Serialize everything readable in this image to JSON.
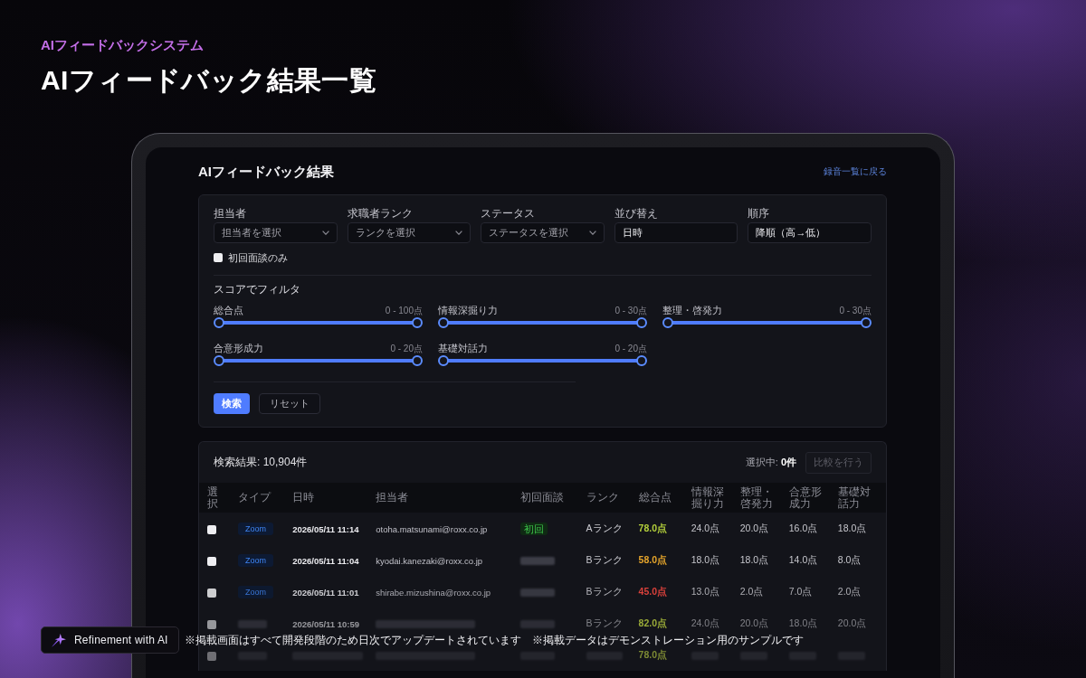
{
  "header": {
    "eyebrow": "AIフィードバックシステム",
    "title": "AIフィードバック結果一覧"
  },
  "screen": {
    "title": "AIフィードバック結果",
    "back_link": "録音一覧に戻る",
    "filters": {
      "fields": [
        {
          "label": "担当者",
          "kind": "select",
          "placeholder": "担当者を選択"
        },
        {
          "label": "求職者ランク",
          "kind": "select",
          "placeholder": "ランクを選択"
        },
        {
          "label": "ステータス",
          "kind": "select",
          "placeholder": "ステータスを選択"
        },
        {
          "label": "並び替え",
          "kind": "input",
          "value": "日時"
        },
        {
          "label": "順序",
          "kind": "input",
          "value": "降順（高→低）"
        }
      ],
      "first_interview_only": {
        "label": "初回面談のみ",
        "checked": false
      },
      "score_heading": "スコアでフィルタ",
      "score_sliders": [
        {
          "label": "総合点",
          "range": "0 - 100点",
          "level": 1
        },
        {
          "label": "情報深掘り力",
          "range": "0 - 30点",
          "level": 1
        },
        {
          "label": "整理・啓発力",
          "range": "0 - 30点",
          "level": 1
        },
        {
          "label": "合意形成力",
          "range": "0 - 20点",
          "level": 1
        },
        {
          "label": "基礎対話力",
          "range": "0 - 20点",
          "level": 1
        }
      ],
      "buttons": [
        {
          "label": "検索",
          "kind": "primary"
        },
        {
          "label": "リセット",
          "kind": "secondary"
        }
      ]
    },
    "results": {
      "count": "検索結果: 10,904件",
      "selection": "選択中: **0件**",
      "compare_button": {
        "label": "比較を行う",
        "disabled": true
      },
      "table": {
        "columns": [
          "選択",
          "タイプ",
          "日時",
          "担当者",
          "初回面談",
          "ランク",
          "総合点",
          "情報深掘り力",
          "整理・啓発力",
          "合意形成力",
          "基礎対話力"
        ],
        "rows": [
          {
            "cells": [
              {
                "kind": "checkbox",
                "checked": false
              },
              {
                "kind": "type_badge",
                "text": "Zoom"
              },
              {
                "kind": "datetime",
                "text": "2026/05/11 11:14"
              },
              {
                "kind": "text",
                "text": "otoha.matsunami@roxx.co.jp"
              },
              {
                "kind": "first_badge",
                "text": "初回"
              },
              {
                "kind": "text",
                "text": "Aランク"
              },
              {
                "kind": "score",
                "text": "78.0点",
                "color": "#b3cf3b"
              },
              {
                "kind": "text",
                "text": "24.0点"
              },
              {
                "kind": "text",
                "text": "20.0点"
              },
              {
                "kind": "text",
                "text": "16.0点"
              },
              {
                "kind": "text",
                "text": "18.0点"
              }
            ]
          },
          {
            "cells": [
              {
                "kind": "checkbox",
                "checked": false
              },
              {
                "kind": "type_badge",
                "text": "Zoom"
              },
              {
                "kind": "datetime",
                "text": "2026/05/11 11:04"
              },
              {
                "kind": "text",
                "text": "kyodai.kanezaki@roxx.co.jp"
              },
              {
                "kind": "blurred"
              },
              {
                "kind": "text",
                "text": "Bランク"
              },
              {
                "kind": "score",
                "text": "58.0点",
                "color": "#e6a52b"
              },
              {
                "kind": "text",
                "text": "18.0点"
              },
              {
                "kind": "text",
                "text": "18.0点"
              },
              {
                "kind": "text",
                "text": "14.0点"
              },
              {
                "kind": "text",
                "text": "8.0点"
              }
            ]
          },
          {
            "cells": [
              {
                "kind": "checkbox",
                "checked": false
              },
              {
                "kind": "type_badge",
                "text": "Zoom"
              },
              {
                "kind": "datetime",
                "text": "2026/05/11 11:01"
              },
              {
                "kind": "text",
                "text": "shirabe.mizushina@roxx.co.jp"
              },
              {
                "kind": "blurred"
              },
              {
                "kind": "text",
                "text": "Bランク"
              },
              {
                "kind": "score",
                "text": "45.0点",
                "color": "#d9413b"
              },
              {
                "kind": "text",
                "text": "13.0点"
              },
              {
                "kind": "text",
                "text": "2.0点"
              },
              {
                "kind": "text",
                "text": "7.0点"
              },
              {
                "kind": "text",
                "text": "2.0点"
              }
            ]
          },
          {
            "cells": [
              {
                "kind": "checkbox",
                "checked": false
              },
              {
                "kind": "blurred"
              },
              {
                "kind": "datetime",
                "text": "2026/05/11 10:59"
              },
              {
                "kind": "blurred"
              },
              {
                "kind": "blurred"
              },
              {
                "kind": "text",
                "text": "Bランク"
              },
              {
                "kind": "score",
                "text": "82.0点",
                "color": "#9aab38"
              },
              {
                "kind": "text",
                "text": "24.0点"
              },
              {
                "kind": "text",
                "text": "20.0点"
              },
              {
                "kind": "text",
                "text": "18.0点"
              },
              {
                "kind": "text",
                "text": "20.0点"
              }
            ]
          },
          {
            "cells": [
              {
                "kind": "checkbox",
                "checked": false
              },
              {
                "kind": "blurred"
              },
              {
                "kind": "blurred"
              },
              {
                "kind": "blurred"
              },
              {
                "kind": "blurred"
              },
              {
                "kind": "blurred"
              },
              {
                "kind": "score",
                "text": "78.0点",
                "color": "#7d8a34"
              },
              {
                "kind": "blurred"
              },
              {
                "kind": "blurred"
              },
              {
                "kind": "blurred"
              },
              {
                "kind": "blurred"
              }
            ]
          }
        ]
      }
    }
  },
  "footer": {
    "badge": "Refinement with AI",
    "notes": [
      "※掲載画面はすべて開発段階のため日次でアップデートされています",
      "※掲載データはデモンストレーション用のサンプルです"
    ]
  }
}
